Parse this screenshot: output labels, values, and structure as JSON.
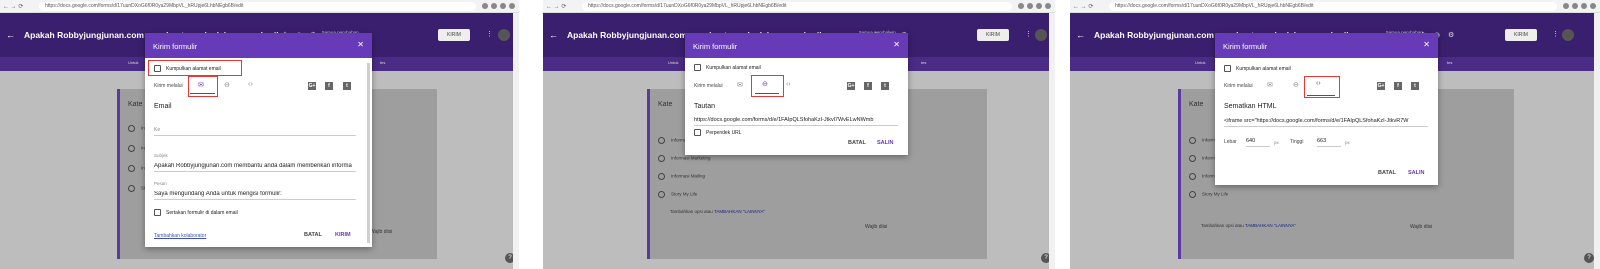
{
  "browser": {
    "urls": [
      "https://docs.google.com/forms/d/17uunDXoG6f0R0ya29MbpVL_hRUpje6LhbNEgb6B/edit",
      "https://docs.google.com/forms/d/17uunDXoG6f0R0ya29MbpVL_hRUpje6LhbNEgb6B/edit",
      "https://docs.google.com/forms/d/17uunDXoG6f0R0ya29MbpVL_hRUpje6LhbNEgb6B/edit"
    ]
  },
  "app": {
    "title": "Apakah Robbyjungjunan.com membantu anda dalam memberika",
    "save_note": "Semua perubahan disimpan di Drive",
    "send_label": "KIRIM",
    "back": "←",
    "more": "⋮"
  },
  "subbar": {
    "left": "Untuk",
    "right": "tes"
  },
  "form": {
    "card_title": "Kate",
    "options": [
      "Informasi Mailing",
      "Informasi Marketing",
      "Informasi Mailing",
      "Story My Life"
    ],
    "add_option": "Tambahkan opsi",
    "or": "atau",
    "add_other": "TAMBAHKAN \"LAINNYA\"",
    "required": "Wajib diisi"
  },
  "dialog": {
    "title": "Kirim formulir",
    "close": "✕",
    "collect_email": "Kumpulkan alamat email",
    "send_via": "Kirim melalui",
    "cancel": "BATAL",
    "send": "KIRIM",
    "copy": "SALIN",
    "email": {
      "heading": "Email",
      "to_placeholder": "Ke",
      "subject_label": "Subjek",
      "subject": "Apakah Robbyjungjunan.com membantu anda dalam memberikan informa",
      "message_label": "Pesan",
      "message": "Saya mengundang Anda untuk mengisi formulir:",
      "include_form": "Sertakan formulir di dalam email",
      "add_collaborators": "Tambahkan kolaborator"
    },
    "link": {
      "heading": "Tautan",
      "url": "https://docs.google.com/forms/d/e/1FAIpQLSfohaKzI-Jtkvl7WvELwNWmb",
      "shorten": "Perpendek URL"
    },
    "embed": {
      "heading": "Sematkan HTML",
      "code": "<iframe src=\"https://docs.google.com/forms/d/e/1FAIpQLSfohaKzI-JtkvR7W",
      "width_label": "Lebar",
      "width": "640",
      "height_label": "Tinggi",
      "height": "663",
      "unit": "px"
    }
  },
  "icons": {
    "email": "✉",
    "link": "⊖",
    "embed": "‹›",
    "gplus": "G+",
    "facebook": "f",
    "twitter": "t"
  }
}
